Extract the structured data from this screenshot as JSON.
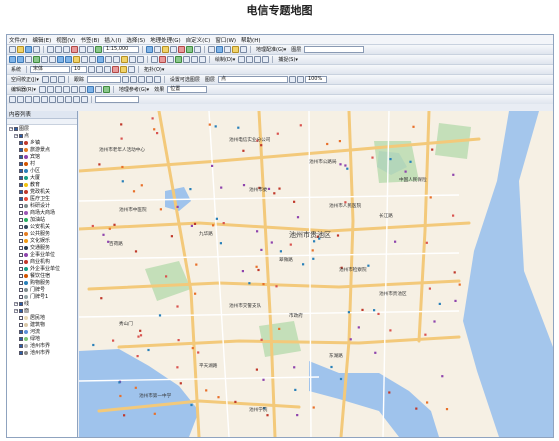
{
  "page_title": "电信专题地图",
  "menu": [
    "文件(F)",
    "编辑(E)",
    "视图(V)",
    "书签(B)",
    "插入(I)",
    "选择(S)",
    "地理处理(G)",
    "自定义(C)",
    "窗口(W)",
    "帮助(H)"
  ],
  "toolbar": {
    "scale": "1:15,000",
    "layout_label": "地理配准(G)▾",
    "layer_label": "图层",
    "editor_label": "编辑器(R)▾",
    "draw_label": "绘制(D)▾",
    "snap_label": "捕捉(S)▾",
    "spatial_adjust": "空间校正(J)▾",
    "drawing_font": "宋体",
    "font_size": "10",
    "layer_select": "点",
    "zoom_value": "100%",
    "system_label": "系统",
    "topo_label": "拓扑(O)▾",
    "set_tolerance": "设置可选图层",
    "georef_label": "地理参考(G)▾",
    "effects_label": "效果",
    "tracking_label": "跟踪",
    "position_field": "位置"
  },
  "toc": {
    "title": "内容列表",
    "layers": [
      {
        "name": "图层",
        "level": 0,
        "checked": true
      },
      {
        "name": "点",
        "level": 1,
        "checked": true
      },
      {
        "name": "乡镇",
        "level": 2,
        "checked": true,
        "color": "#c0392b"
      },
      {
        "name": "旅游景点",
        "level": 2,
        "checked": true,
        "color": "#e67e22"
      },
      {
        "name": "宾馆",
        "level": 2,
        "checked": true,
        "color": "#8e44ad"
      },
      {
        "name": "村",
        "level": 2,
        "checked": true,
        "color": "#d35400"
      },
      {
        "name": "小区",
        "level": 2,
        "checked": true,
        "color": "#2980b9"
      },
      {
        "name": "大厦",
        "level": 2,
        "checked": true,
        "color": "#16a085"
      },
      {
        "name": "教育",
        "level": 2,
        "checked": true,
        "color": "#f1c40f"
      },
      {
        "name": "党政机关",
        "level": 2,
        "checked": true,
        "color": "#c0392b"
      },
      {
        "name": "医疗卫生",
        "level": 2,
        "checked": true,
        "color": "#e74c3c"
      },
      {
        "name": "科研设计",
        "level": 2,
        "checked": false,
        "color": "#7f8c8d"
      },
      {
        "name": "商场大商场",
        "level": 2,
        "checked": false,
        "color": "#9b59b6"
      },
      {
        "name": "加油站",
        "level": 2,
        "checked": false,
        "color": "#27ae60"
      },
      {
        "name": "公安机关",
        "level": 2,
        "checked": false,
        "color": "#34495e"
      },
      {
        "name": "公共服务",
        "level": 2,
        "checked": false,
        "color": "#e67e22"
      },
      {
        "name": "文化娱乐",
        "level": 2,
        "checked": false,
        "color": "#f39c12"
      },
      {
        "name": "交通服务",
        "level": 2,
        "checked": false,
        "color": "#2c3e50"
      },
      {
        "name": "企事业单位",
        "level": 2,
        "checked": false,
        "color": "#8e44ad"
      },
      {
        "name": "商业机构",
        "level": 2,
        "checked": false,
        "color": "#c0392b"
      },
      {
        "name": "外企事业单位",
        "level": 2,
        "checked": false,
        "color": "#16a085"
      },
      {
        "name": "餐饮住宿",
        "level": 2,
        "checked": false,
        "color": "#d35400"
      },
      {
        "name": "购物服务",
        "level": 2,
        "checked": false,
        "color": "#2980b9"
      },
      {
        "name": "门牌号",
        "level": 2,
        "checked": false,
        "color": "#7f8c8d"
      },
      {
        "name": "门牌号1",
        "level": 2,
        "checked": false,
        "color": "#95a5a6"
      },
      {
        "name": "线",
        "level": 1,
        "checked": true
      },
      {
        "name": "面",
        "level": 1,
        "checked": true
      },
      {
        "name": "居民地",
        "level": 2,
        "checked": false,
        "color": "#e8d9b5"
      },
      {
        "name": "建筑物",
        "level": 2,
        "checked": false,
        "color": "#d9c7a7"
      },
      {
        "name": "河流",
        "level": 2,
        "checked": true,
        "color": "#5b8fd6"
      },
      {
        "name": "绿地",
        "level": 2,
        "checked": true,
        "color": "#7cc576"
      },
      {
        "name": "池州市界",
        "level": 2,
        "checked": true,
        "color": "#b5b5b5"
      },
      {
        "name": "池州市界",
        "level": 2,
        "checked": true,
        "color": "#888888"
      }
    ]
  },
  "map": {
    "labels": [
      "池州市老年人活动中心",
      "池州电信实业分公司",
      "池州市公路局",
      "池州市委",
      "池州市中医院",
      "池州市人民医院",
      "长江路",
      "百荷路",
      "九华路",
      "翠微路",
      "池州市检察院",
      "池州市贵池区",
      "中国人民保险",
      "池州市交警支队",
      "秀山门",
      "市政府",
      "平天湖路",
      "东湖路",
      "池州市第一中学",
      "池州学院"
    ],
    "district_label": "池州市贵池区"
  }
}
